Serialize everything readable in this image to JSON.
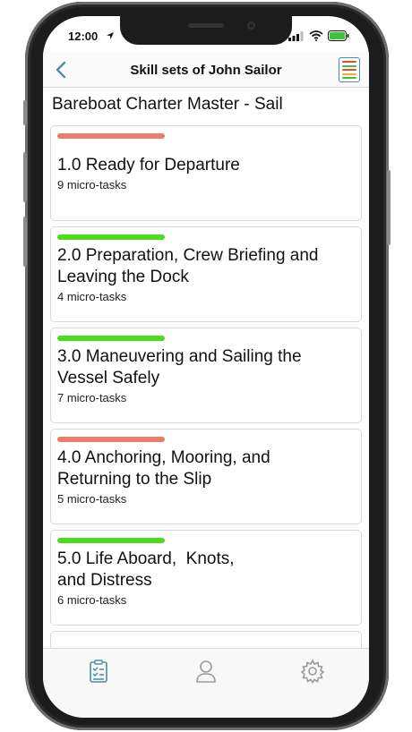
{
  "status": {
    "time": "12:00"
  },
  "nav": {
    "title": "Skill sets of John Sailor"
  },
  "heading": "Bareboat Charter Master - Sail",
  "skills": [
    {
      "title_line1": "1.0 Ready for Departure",
      "title_line2": "",
      "subtitle": "9 micro-tasks",
      "status_color": "#e87d6a"
    },
    {
      "title_line1": "2.0 Preparation, Crew Briefing and",
      "title_line2": "Leaving the Dock",
      "subtitle": "4 micro-tasks",
      "status_color": "#4cdc1e"
    },
    {
      "title_line1": "3.0 Maneuvering and Sailing the",
      "title_line2": "Vessel Safely",
      "subtitle": "7 micro-tasks",
      "status_color": "#4cdc1e"
    },
    {
      "title_line1": "4.0 Anchoring, Mooring, and",
      "title_line2": "Returning to the Slip",
      "subtitle": "5 micro-tasks",
      "status_color": "#e87d6a"
    },
    {
      "title_line1": "5.0 Life Aboard,  Knots,",
      "title_line2": "and Distress",
      "subtitle": "6 micro-tasks",
      "status_color": "#4cdc1e"
    }
  ],
  "tabs": [
    {
      "icon": "checklist-icon",
      "active": true
    },
    {
      "icon": "person-icon",
      "active": false
    },
    {
      "icon": "gear-icon",
      "active": false
    }
  ],
  "colors": {
    "accent": "#4a90a4",
    "bar_red": "#e87d6a",
    "bar_green": "#4cdc1e"
  }
}
